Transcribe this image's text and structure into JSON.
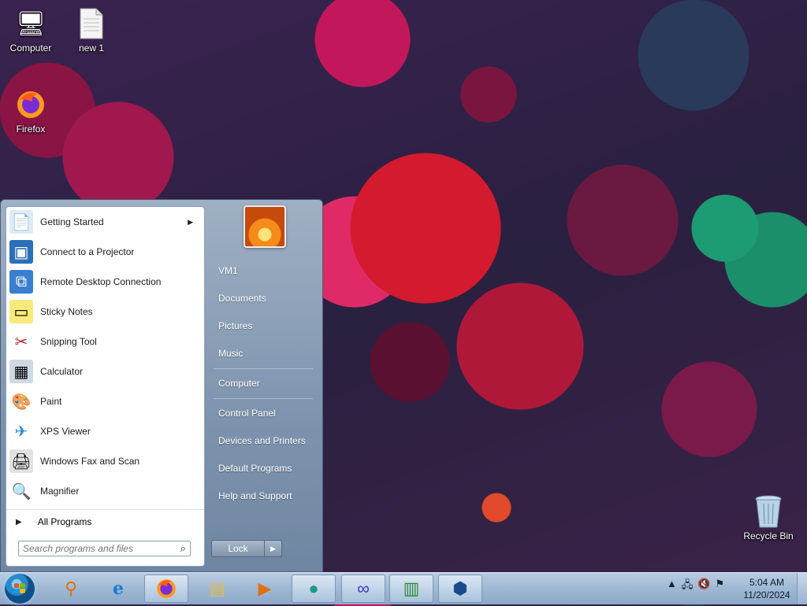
{
  "desktop": {
    "icons": [
      {
        "label": "Computer",
        "icon": "computer-icon"
      },
      {
        "label": "new 1",
        "icon": "text-file-icon"
      },
      {
        "label": "Firefox",
        "icon": "firefox-icon"
      },
      {
        "label": "Recycle Bin",
        "icon": "recycle-bin-icon"
      }
    ]
  },
  "start_menu": {
    "programs": [
      {
        "label": "Getting Started",
        "icon": "getting-started-icon",
        "has_submenu": true
      },
      {
        "label": "Connect to a Projector",
        "icon": "projector-icon"
      },
      {
        "label": "Remote Desktop Connection",
        "icon": "remote-desktop-icon"
      },
      {
        "label": "Sticky Notes",
        "icon": "sticky-notes-icon"
      },
      {
        "label": "Snipping Tool",
        "icon": "snipping-tool-icon"
      },
      {
        "label": "Calculator",
        "icon": "calculator-icon"
      },
      {
        "label": "Paint",
        "icon": "paint-icon"
      },
      {
        "label": "XPS Viewer",
        "icon": "xps-viewer-icon"
      },
      {
        "label": "Windows Fax and Scan",
        "icon": "fax-scan-icon"
      },
      {
        "label": "Magnifier",
        "icon": "magnifier-icon"
      }
    ],
    "all_programs": "All Programs",
    "search_placeholder": "Search programs and files",
    "right_links": [
      "VM1",
      "Documents",
      "Pictures",
      "Music",
      "Computer",
      "Control Panel",
      "Devices and Printers",
      "Default Programs",
      "Help and Support"
    ],
    "lock_label": "Lock"
  },
  "taskbar": {
    "pinned": [
      {
        "icon": "search-magnifier-icon"
      },
      {
        "icon": "internet-explorer-icon"
      },
      {
        "icon": "firefox-icon",
        "active": true
      },
      {
        "icon": "file-explorer-icon"
      },
      {
        "icon": "media-player-icon"
      },
      {
        "icon": "app-teal-icon",
        "active": true
      },
      {
        "icon": "infinity-app-icon",
        "active": true
      },
      {
        "icon": "spreadsheet-app-icon",
        "active": true
      },
      {
        "icon": "virtualbox-icon",
        "active": true
      }
    ],
    "clock_time": "5:04 AM",
    "clock_date": "11/20/2024"
  }
}
